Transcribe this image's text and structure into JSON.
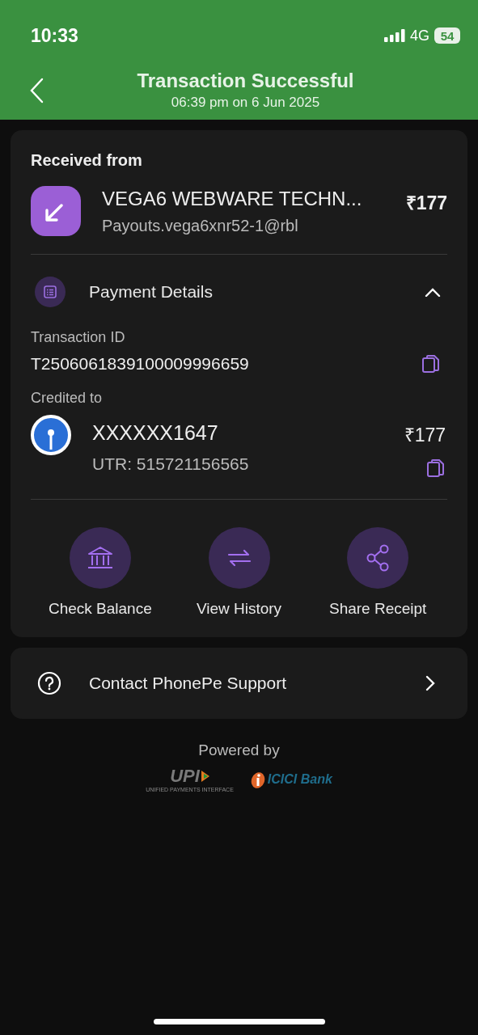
{
  "status_bar": {
    "time": "10:33",
    "network": "4G",
    "battery": "54"
  },
  "header": {
    "title": "Transaction Successful",
    "subtitle": "06:39 pm on 6 Jun 2025"
  },
  "received": {
    "heading": "Received from",
    "name": "VEGA6 WEBWARE TECHN...",
    "amount": "₹177",
    "upi_id": "Payouts.vega6xnr52-1@rbl"
  },
  "payment_details": {
    "title": "Payment Details",
    "expanded": true,
    "transaction_id_label": "Transaction ID",
    "transaction_id": "T2506061839100009996659",
    "credited_label": "Credited to",
    "account": "XXXXXX1647",
    "amount": "₹177",
    "utr": "UTR: 515721156565"
  },
  "actions": [
    {
      "kind": "bank",
      "label": "Check Balance"
    },
    {
      "kind": "history",
      "label": "View History"
    },
    {
      "kind": "share",
      "label": "Share Receipt"
    }
  ],
  "support": {
    "label": "Contact PhonePe Support"
  },
  "footer": {
    "powered_by": "Powered by",
    "upi_logo": "UPI",
    "upi_tagline": "UNIFIED PAYMENTS INTERFACE",
    "bank_logo": "ICICI Bank"
  }
}
